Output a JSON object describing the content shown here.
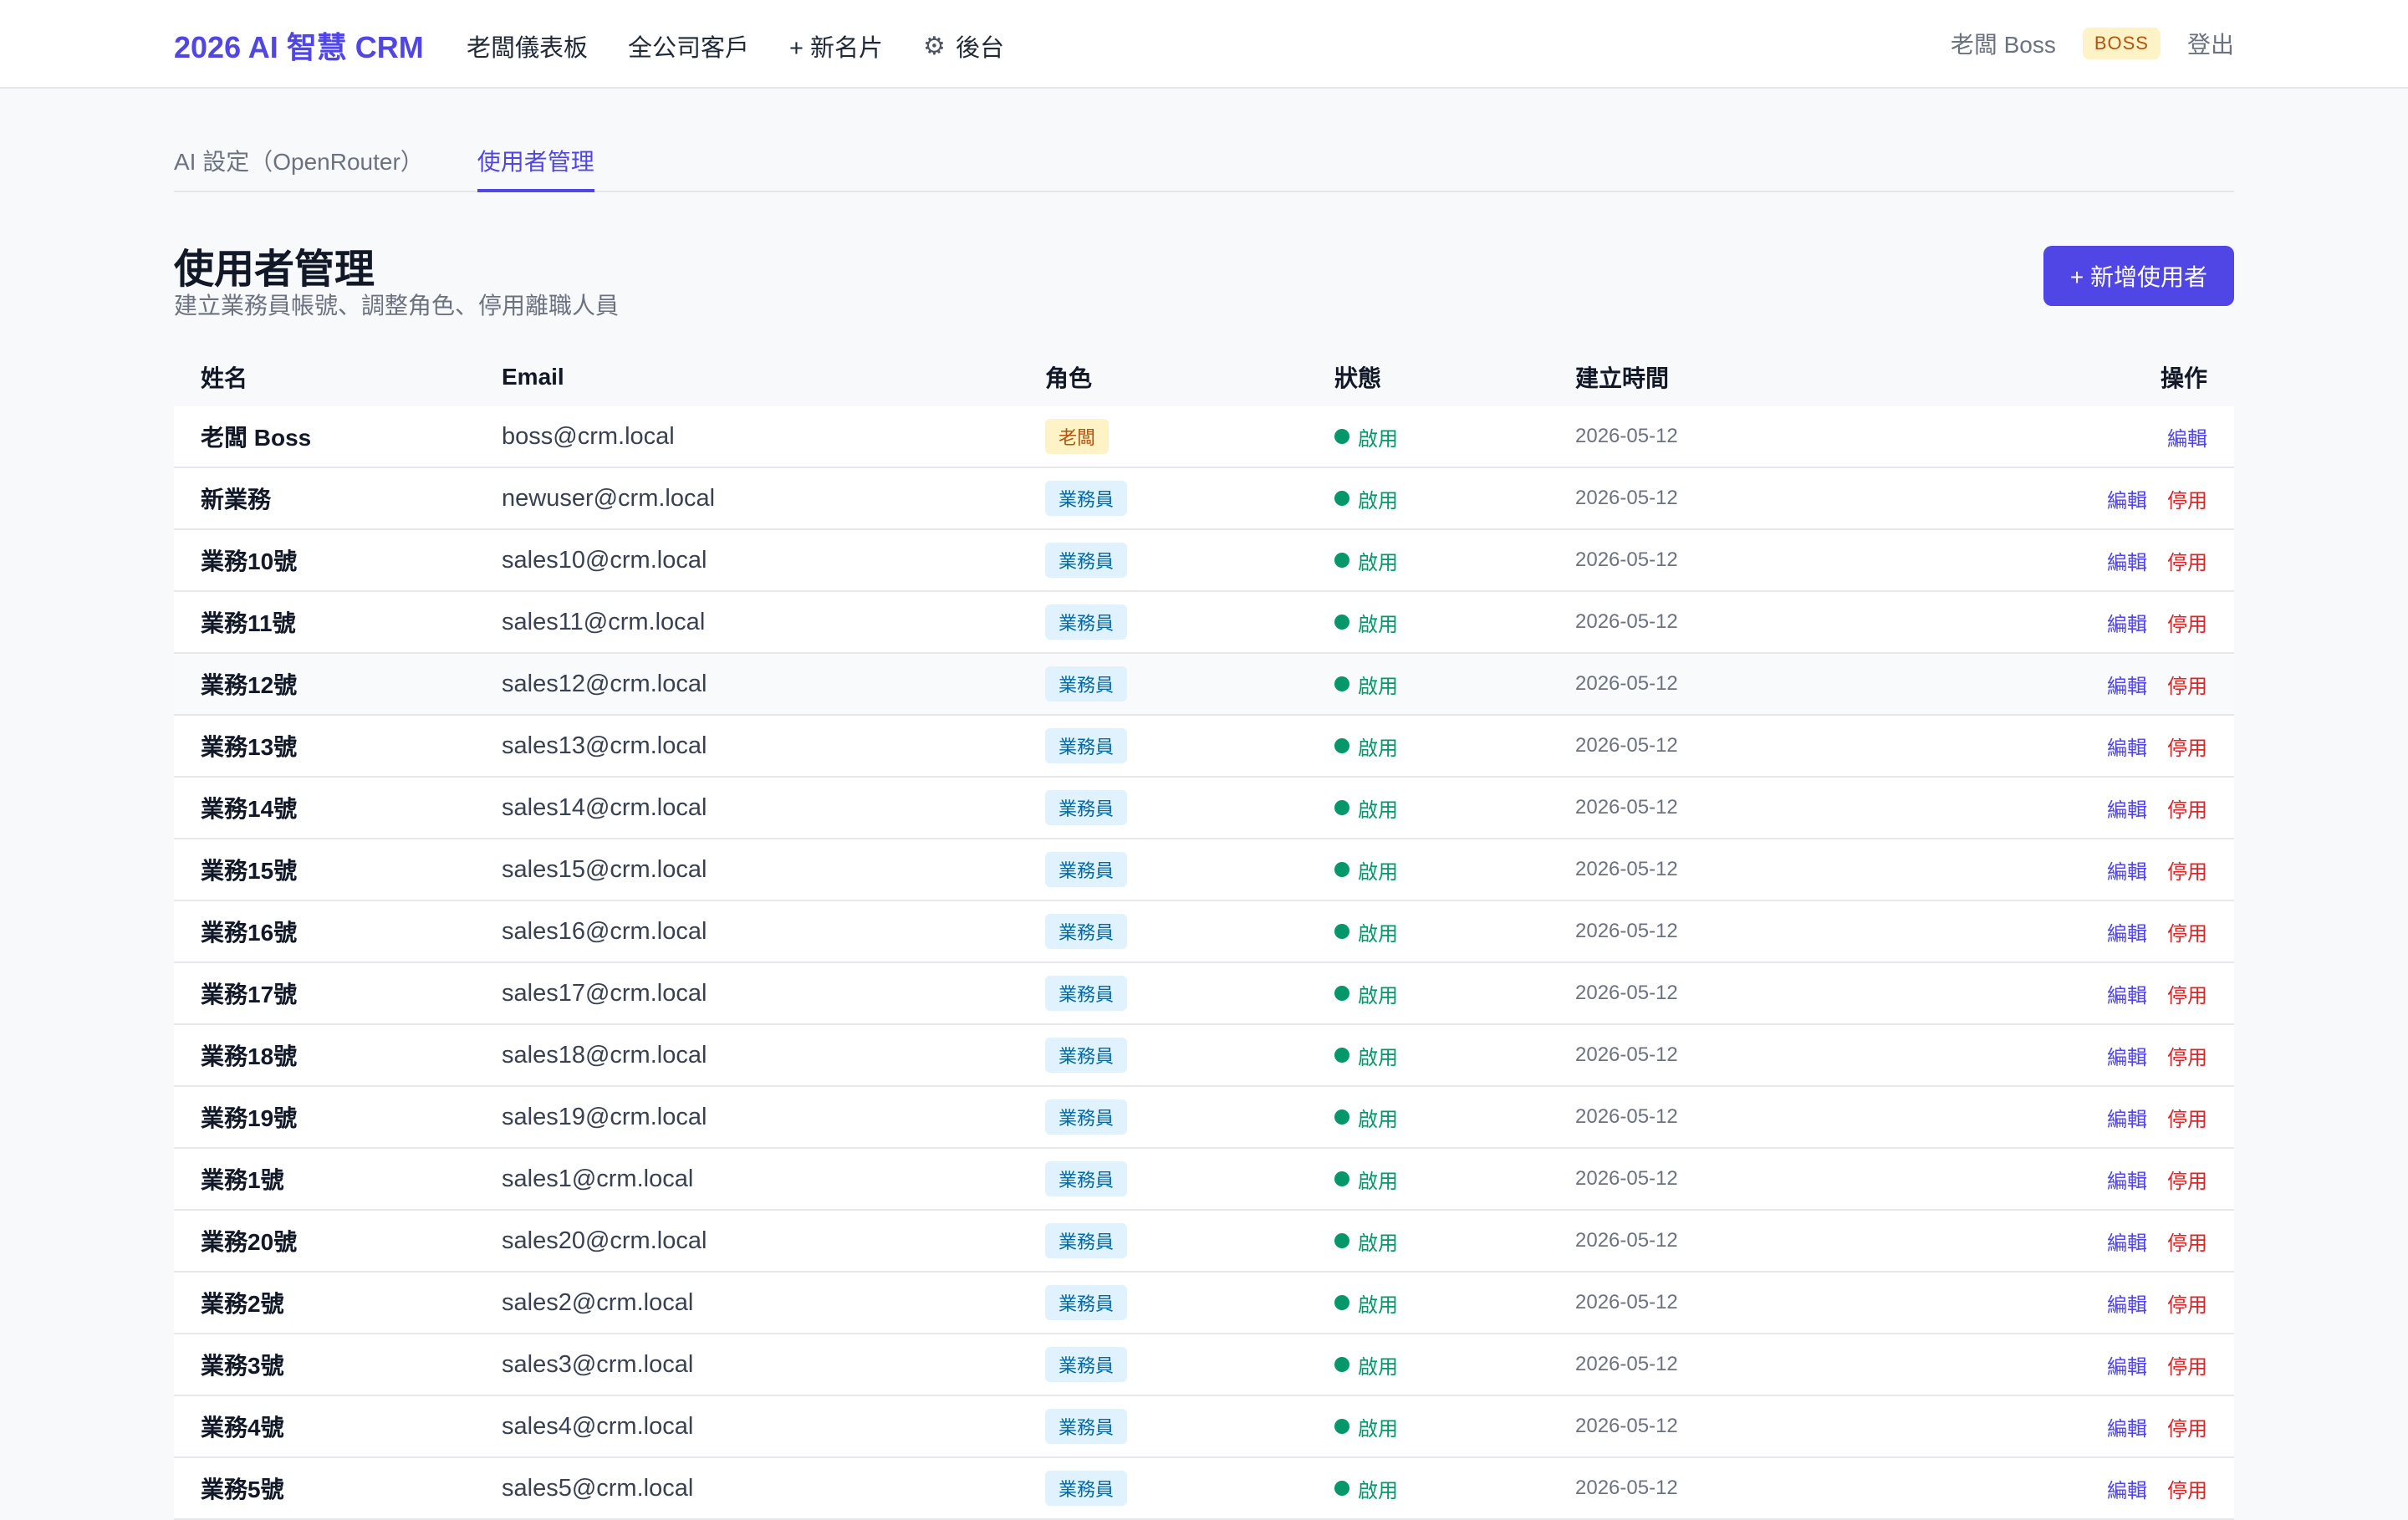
{
  "header": {
    "brand": "2026 AI 智慧 CRM",
    "nav": {
      "dashboard": "老闆儀表板",
      "customers": "全公司客戶",
      "new_card": "+ 新名片",
      "admin_icon": "gear-icon",
      "admin": "後台"
    },
    "user_name": "老闆 Boss",
    "role_badge": "BOSS",
    "logout": "登出"
  },
  "tabs": {
    "ai_settings": "AI 設定（OpenRouter）",
    "users": "使用者管理",
    "active": "users"
  },
  "page": {
    "title": "使用者管理",
    "subtitle": "建立業務員帳號、調整角色、停用離職人員",
    "add_button": "+ 新增使用者"
  },
  "table": {
    "headers": {
      "name": "姓名",
      "email": "Email",
      "role": "角色",
      "status": "狀態",
      "created": "建立時間",
      "ops": "操作"
    },
    "op_labels": {
      "edit": "編輯",
      "disable": "停用"
    },
    "rows": [
      {
        "name": "老闆 Boss",
        "email": "boss@crm.local",
        "role": "老闆",
        "status": "啟用",
        "created": "2026-05-12"
      },
      {
        "name": "新業務",
        "email": "newuser@crm.local",
        "role": "業務員",
        "status": "啟用",
        "created": "2026-05-12"
      },
      {
        "name": "業務10號",
        "email": "sales10@crm.local",
        "role": "業務員",
        "status": "啟用",
        "created": "2026-05-12"
      },
      {
        "name": "業務11號",
        "email": "sales11@crm.local",
        "role": "業務員",
        "status": "啟用",
        "created": "2026-05-12"
      },
      {
        "name": "業務12號",
        "email": "sales12@crm.local",
        "role": "業務員",
        "status": "啟用",
        "created": "2026-05-12"
      },
      {
        "name": "業務13號",
        "email": "sales13@crm.local",
        "role": "業務員",
        "status": "啟用",
        "created": "2026-05-12"
      },
      {
        "name": "業務14號",
        "email": "sales14@crm.local",
        "role": "業務員",
        "status": "啟用",
        "created": "2026-05-12"
      },
      {
        "name": "業務15號",
        "email": "sales15@crm.local",
        "role": "業務員",
        "status": "啟用",
        "created": "2026-05-12"
      },
      {
        "name": "業務16號",
        "email": "sales16@crm.local",
        "role": "業務員",
        "status": "啟用",
        "created": "2026-05-12"
      },
      {
        "name": "業務17號",
        "email": "sales17@crm.local",
        "role": "業務員",
        "status": "啟用",
        "created": "2026-05-12"
      },
      {
        "name": "業務18號",
        "email": "sales18@crm.local",
        "role": "業務員",
        "status": "啟用",
        "created": "2026-05-12"
      },
      {
        "name": "業務19號",
        "email": "sales19@crm.local",
        "role": "業務員",
        "status": "啟用",
        "created": "2026-05-12"
      },
      {
        "name": "業務1號",
        "email": "sales1@crm.local",
        "role": "業務員",
        "status": "啟用",
        "created": "2026-05-12"
      },
      {
        "name": "業務20號",
        "email": "sales20@crm.local",
        "role": "業務員",
        "status": "啟用",
        "created": "2026-05-12"
      },
      {
        "name": "業務2號",
        "email": "sales2@crm.local",
        "role": "業務員",
        "status": "啟用",
        "created": "2026-05-12"
      },
      {
        "name": "業務3號",
        "email": "sales3@crm.local",
        "role": "業務員",
        "status": "啟用",
        "created": "2026-05-12"
      },
      {
        "name": "業務4號",
        "email": "sales4@crm.local",
        "role": "業務員",
        "status": "啟用",
        "created": "2026-05-12"
      },
      {
        "name": "業務5號",
        "email": "sales5@crm.local",
        "role": "業務員",
        "status": "啟用",
        "created": "2026-05-12"
      }
    ]
  },
  "colors": {
    "accent": "#4f46e5",
    "active_status": "#059669",
    "danger": "#dc2626",
    "boss_badge_bg": "#fef3c7",
    "sales_badge_bg": "#e0f2fe"
  }
}
